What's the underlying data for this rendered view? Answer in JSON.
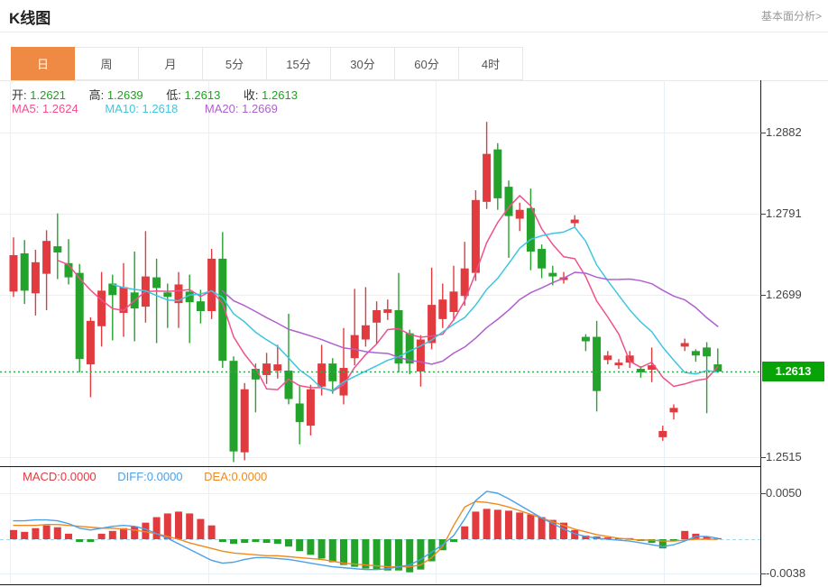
{
  "header": {
    "title": "K线图",
    "link": "基本面分析>"
  },
  "tabs": {
    "items": [
      {
        "label": "日"
      },
      {
        "label": "周"
      },
      {
        "label": "月"
      },
      {
        "label": "5分"
      },
      {
        "label": "15分"
      },
      {
        "label": "30分"
      },
      {
        "label": "60分"
      },
      {
        "label": "4时"
      }
    ],
    "active_index": 0
  },
  "quote": {
    "open_label": "开:",
    "open": "1.2621",
    "high_label": "高:",
    "high": "1.2639",
    "low_label": "低:",
    "low": "1.2613",
    "close_label": "收:",
    "close": "1.2613"
  },
  "ma_legend": {
    "ma5": "MA5: 1.2624",
    "ma10": "MA10: 1.2618",
    "ma20": "MA20: 1.2669"
  },
  "macd_legend": {
    "macd": "MACD:0.0000",
    "diff": "DIFF:0.0000",
    "dea": "DEA:0.0000"
  },
  "axis": {
    "main_labels": [
      {
        "text": "1.2882"
      },
      {
        "text": "1.2791"
      },
      {
        "text": "1.2699"
      },
      {
        "text": "1.2515"
      }
    ],
    "price_tag": "1.2613",
    "macd_labels": [
      {
        "text": "0.0050"
      },
      {
        "text": "-0.0038"
      }
    ]
  },
  "colors": {
    "accent": "#ef8a45",
    "up": "#e23b3f",
    "down": "#23a32b",
    "ma5": "#f0508e",
    "ma10": "#3ec6e0",
    "ma20": "#b05fd0",
    "diff": "#4ba0e8",
    "dea": "#f08a1e",
    "grid": "#e9eff6",
    "frame": "#1a1a1a",
    "rule": "#e8e8e8",
    "zero_dash": "#a9d6f2",
    "price_line": "#2fae4a",
    "tag_bg": "#07a307",
    "quote_green": "#1ba31b"
  },
  "chart_data": {
    "type": "candlestick",
    "title": "K线图 (daily)",
    "legend_position": "top-left",
    "grid": true,
    "y_axis_ticks": [
      "1.2882",
      "1.2791",
      "1.2699",
      "1.2515"
    ],
    "current_price": 1.2613,
    "ylim": [
      1.2495,
      1.29
    ],
    "ma_periods": [
      5,
      10,
      20
    ],
    "candles_columns": [
      "open",
      "high",
      "low",
      "close"
    ],
    "candles": [
      [
        1.2703,
        1.2764,
        1.2697,
        1.2744
      ],
      [
        1.2746,
        1.2761,
        1.2689,
        1.2704
      ],
      [
        1.2701,
        1.275,
        1.2676,
        1.2736
      ],
      [
        1.2723,
        1.2772,
        1.2682,
        1.276
      ],
      [
        1.2754,
        1.2791,
        1.2717,
        1.2747
      ],
      [
        1.2735,
        1.2762,
        1.2711,
        1.2719
      ],
      [
        1.2724,
        1.2734,
        1.2612,
        1.2627
      ],
      [
        1.2621,
        1.2674,
        1.2584,
        1.267
      ],
      [
        1.2664,
        1.2725,
        1.2641,
        1.2704
      ],
      [
        1.2712,
        1.2722,
        1.2648,
        1.2699
      ],
      [
        1.2679,
        1.2735,
        1.2652,
        1.2708
      ],
      [
        1.2702,
        1.2748,
        1.2647,
        1.2684
      ],
      [
        1.2686,
        1.2771,
        1.2668,
        1.272
      ],
      [
        1.2719,
        1.274,
        1.2645,
        1.2707
      ],
      [
        1.2702,
        1.2712,
        1.2662,
        1.2697
      ],
      [
        1.269,
        1.2725,
        1.2662,
        1.2711
      ],
      [
        1.2703,
        1.2722,
        1.2645,
        1.2691
      ],
      [
        1.2692,
        1.2705,
        1.2667,
        1.2681
      ],
      [
        1.2681,
        1.2751,
        1.2672,
        1.274
      ],
      [
        1.274,
        1.277,
        1.2617,
        1.2625
      ],
      [
        1.2625,
        1.263,
        1.2511,
        1.2523
      ],
      [
        1.2522,
        1.26,
        1.2513,
        1.2593
      ],
      [
        1.2616,
        1.2622,
        1.2567,
        1.2604
      ],
      [
        1.2609,
        1.2634,
        1.2599,
        1.2622
      ],
      [
        1.2614,
        1.2643,
        1.2605,
        1.2621
      ],
      [
        1.2614,
        1.2678,
        1.2576,
        1.2582
      ],
      [
        1.2577,
        1.2598,
        1.2531,
        1.2556
      ],
      [
        1.2552,
        1.2598,
        1.2541,
        1.2593
      ],
      [
        1.2596,
        1.2643,
        1.2586,
        1.2622
      ],
      [
        1.2622,
        1.2628,
        1.2588,
        1.2602
      ],
      [
        1.2586,
        1.2662,
        1.2576,
        1.2617
      ],
      [
        1.2628,
        1.2706,
        1.262,
        1.2654
      ],
      [
        1.2649,
        1.2708,
        1.2641,
        1.2665
      ],
      [
        1.2668,
        1.2692,
        1.2644,
        1.2682
      ],
      [
        1.2679,
        1.2694,
        1.2671,
        1.2683
      ],
      [
        1.2682,
        1.2724,
        1.2612,
        1.2622
      ],
      [
        1.2656,
        1.266,
        1.261,
        1.2622
      ],
      [
        1.2613,
        1.2654,
        1.2596,
        1.2649
      ],
      [
        1.2645,
        1.273,
        1.2638,
        1.2688
      ],
      [
        1.2672,
        1.2712,
        1.2662,
        1.2694
      ],
      [
        1.268,
        1.2732,
        1.267,
        1.2703
      ],
      [
        1.2698,
        1.2759,
        1.2687,
        1.2729
      ],
      [
        1.2724,
        1.2817,
        1.2715,
        1.2806
      ],
      [
        1.2804,
        1.2894,
        1.2796,
        1.2858
      ],
      [
        1.2863,
        1.287,
        1.2795,
        1.2808
      ],
      [
        1.2821,
        1.2828,
        1.2741,
        1.2788
      ],
      [
        1.2785,
        1.2803,
        1.2771,
        1.2795
      ],
      [
        1.2797,
        1.2819,
        1.2727,
        1.2748
      ],
      [
        1.2751,
        1.2756,
        1.2718,
        1.2729
      ],
      [
        1.2724,
        1.2732,
        1.271,
        1.272
      ],
      [
        1.2716,
        1.2725,
        1.2712,
        1.2719
      ],
      [
        1.278,
        1.2789,
        1.2776,
        1.2784
      ],
      [
        1.2652,
        1.2655,
        1.2636,
        1.2647
      ],
      [
        1.2652,
        1.267,
        1.2568,
        1.2591
      ],
      [
        1.2626,
        1.2636,
        1.2621,
        1.2631
      ],
      [
        1.262,
        1.2627,
        1.2616,
        1.2623
      ],
      [
        1.2623,
        1.2636,
        1.2617,
        1.2631
      ],
      [
        1.2616,
        1.2619,
        1.2606,
        1.2612
      ],
      [
        1.2615,
        1.264,
        1.2601,
        1.262
      ],
      [
        1.2539,
        1.2552,
        1.2535,
        1.2546
      ],
      [
        1.2567,
        1.2576,
        1.2559,
        1.2572
      ],
      [
        1.2641,
        1.265,
        1.2636,
        1.2645
      ],
      [
        1.2636,
        1.2638,
        1.2624,
        1.2631
      ],
      [
        1.264,
        1.2646,
        1.2566,
        1.263
      ],
      [
        1.2621,
        1.2639,
        1.2613,
        1.2613
      ]
    ],
    "macd": {
      "unit": 0.0001,
      "ylim": [
        -0.0038,
        0.005
      ],
      "ticks": [
        "0.0050",
        "-0.0038"
      ],
      "bars": [
        10,
        8,
        12,
        15,
        13,
        6,
        -3,
        -3,
        6,
        9,
        12,
        14,
        18,
        24,
        28,
        30,
        28,
        22,
        15,
        -3,
        -5,
        -4,
        -3,
        -4,
        -5,
        -8,
        -13,
        -17,
        -21,
        -25,
        -28,
        -30,
        -32,
        -33,
        -34,
        -34,
        -36,
        -33,
        -24,
        -12,
        -3,
        14,
        30,
        33,
        32,
        31,
        29,
        27,
        24,
        21,
        18,
        10,
        4,
        3,
        2,
        1,
        1,
        -2,
        -4,
        -10,
        -2,
        9,
        6,
        3,
        0
      ],
      "diff": [
        20,
        20,
        21,
        21,
        20,
        17,
        12,
        10,
        12,
        14,
        15,
        14,
        11,
        6,
        1,
        -5,
        -11,
        -17,
        -23,
        -26,
        -25,
        -22,
        -20,
        -20,
        -21,
        -22,
        -24,
        -26,
        -28,
        -30,
        -31,
        -32,
        -33,
        -33,
        -32,
        -30,
        -28,
        -22,
        -14,
        -6,
        4,
        22,
        42,
        52,
        50,
        44,
        37,
        30,
        23,
        17,
        11,
        6,
        3,
        1,
        0,
        -1,
        -2,
        -4,
        -6,
        -8,
        -6,
        -2,
        3,
        3,
        1
      ],
      "dea": [
        15,
        15,
        15,
        16,
        16,
        15,
        14,
        13,
        12,
        12,
        11,
        10,
        8,
        6,
        3,
        0,
        -4,
        -7,
        -10,
        -13,
        -15,
        -16,
        -17,
        -18,
        -18,
        -19,
        -20,
        -21,
        -22,
        -24,
        -26,
        -27,
        -28,
        -29,
        -30,
        -30,
        -30,
        -28,
        -20,
        -8,
        15,
        35,
        41,
        40,
        38,
        35,
        31,
        27,
        23,
        19,
        15,
        11,
        8,
        5,
        3,
        1,
        0,
        -1,
        -1,
        -2,
        -2,
        -1,
        0,
        0,
        0
      ]
    }
  }
}
